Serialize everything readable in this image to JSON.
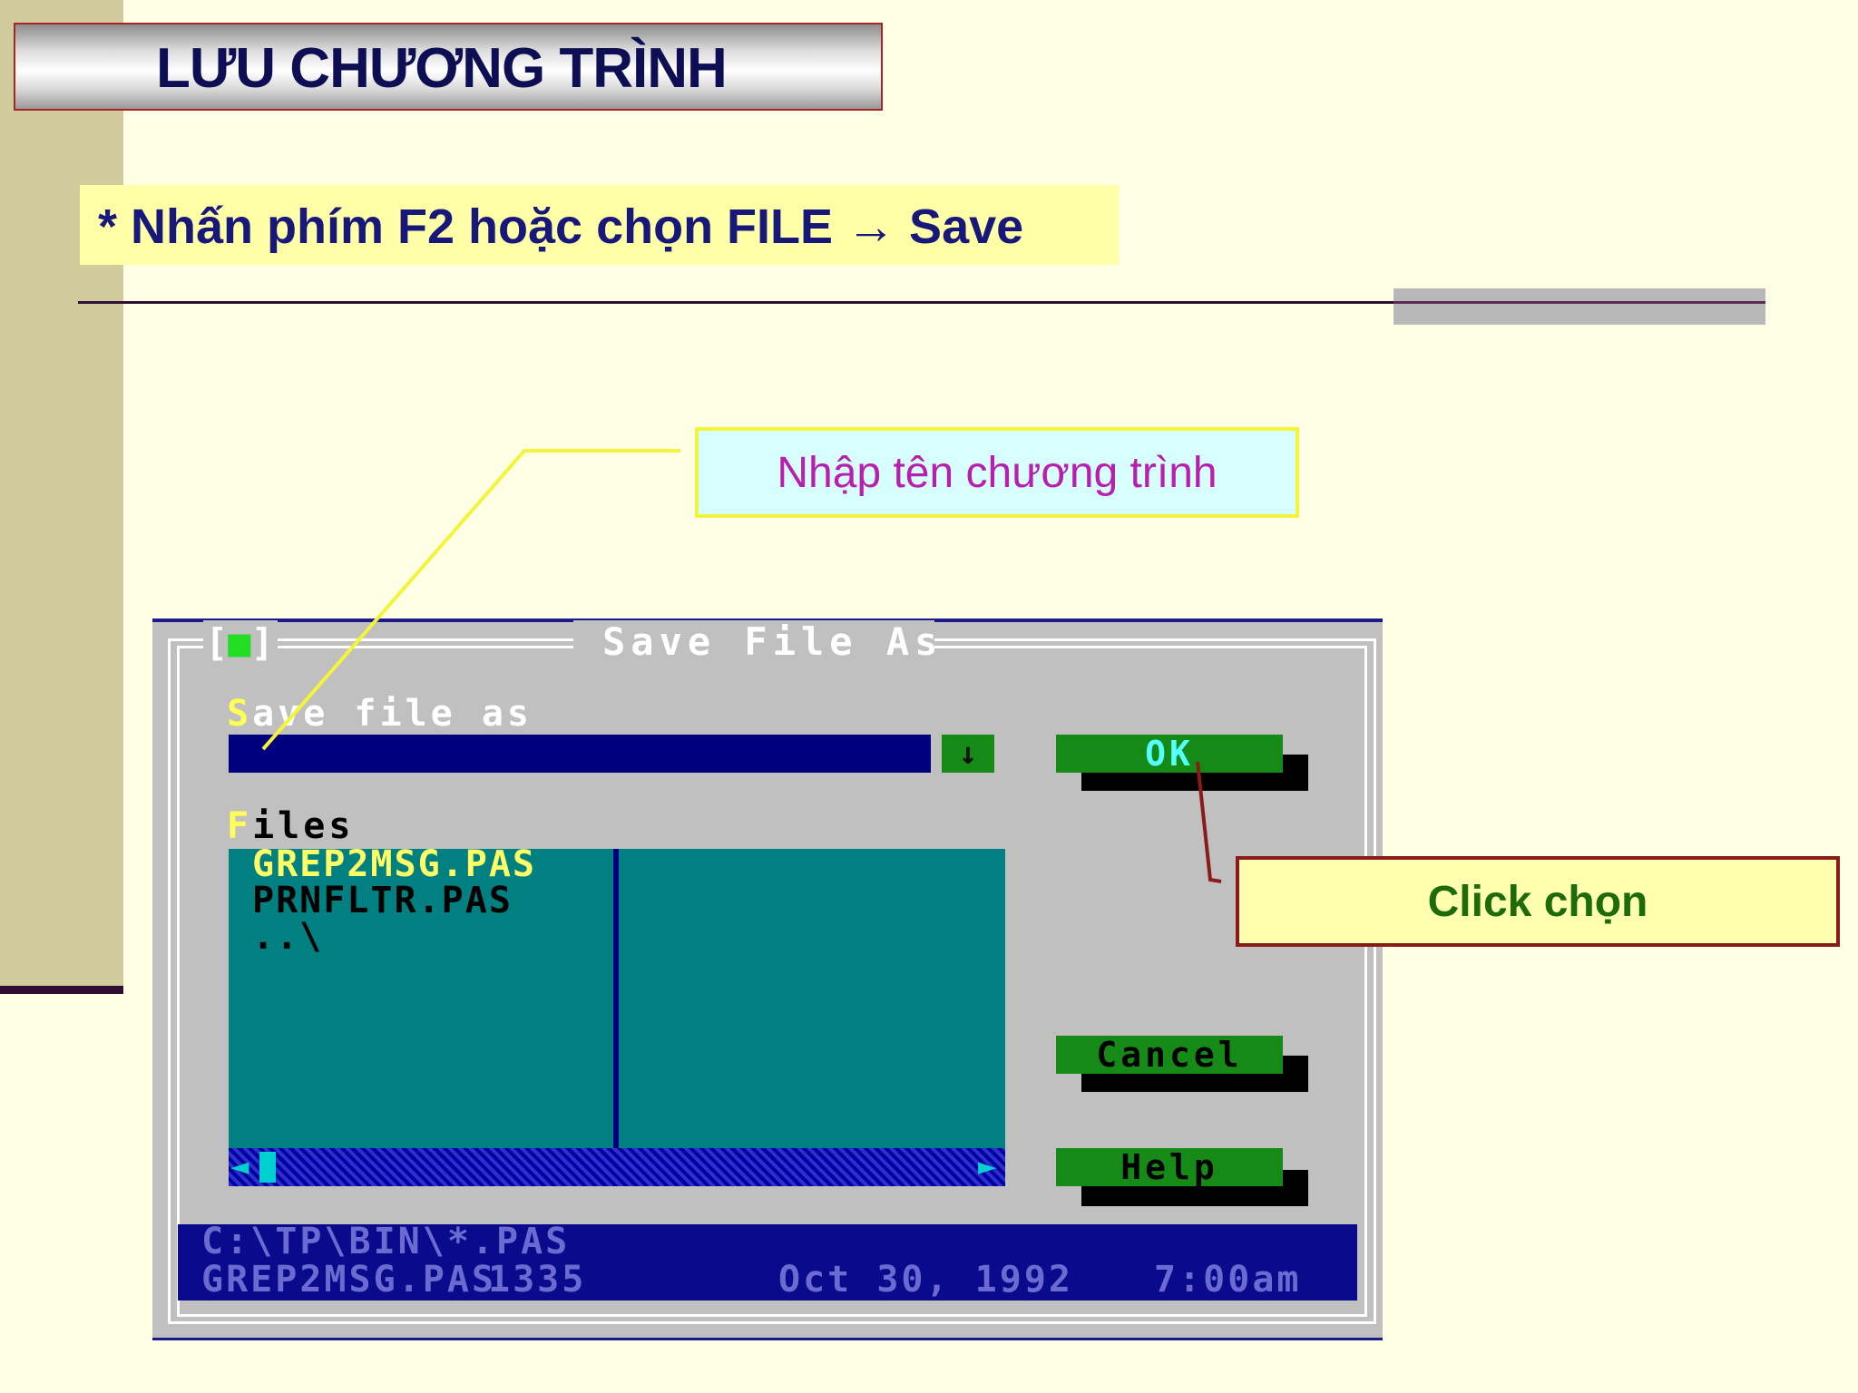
{
  "slide": {
    "title": "LƯU CHƯƠNG TRÌNH",
    "subtitle": "* Nhấn phím F2 hoặc chọn FILE → Save"
  },
  "callouts": {
    "enter_name": "Nhập tên chương trình",
    "click": "Click chọn"
  },
  "dialog": {
    "close_box": "[■]",
    "title": "Save File As",
    "save_label_hotkey": "S",
    "save_label_rest": "ave file as",
    "save_value": "",
    "history_arrow": "↓",
    "files_label_hotkey": "F",
    "files_label_rest": "iles",
    "files": [
      "GREP2MSG.PAS",
      "PRNFLTR.PAS",
      "..\\"
    ],
    "scroll_left": "◄",
    "scroll_right": "►",
    "buttons": {
      "ok": "OK",
      "cancel": "Cancel",
      "help": "Help"
    },
    "status": {
      "path": "C:\\TP\\BIN\\*.PAS",
      "file": "GREP2MSG.PAS",
      "size": "1335",
      "date": "Oct 30, 1992",
      "time": "7:00am"
    }
  },
  "colors": {
    "background": "#FFFFE5",
    "title_text": "#0E0E55",
    "callout_name_text": "#B81FB0",
    "callout_click_text": "#1E6B0A",
    "dos_button": "#168A16",
    "file_list": "#008080"
  }
}
